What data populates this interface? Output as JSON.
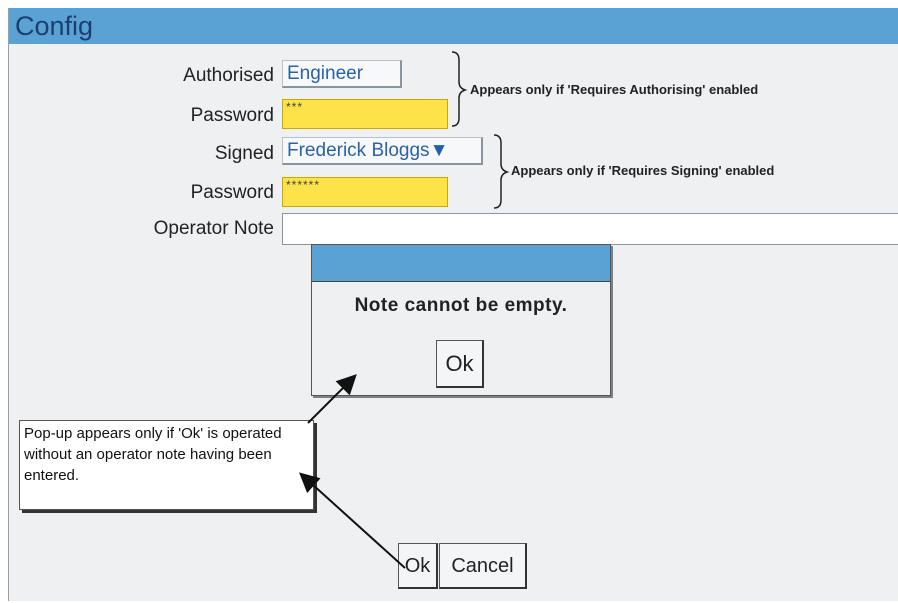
{
  "window": {
    "title": "Config"
  },
  "form": {
    "authorised_label": "Authorised",
    "authorised_value": "Engineer",
    "password1_label": "Password",
    "password1_mask": "***",
    "signed_label": "Signed",
    "signed_value": "Frederick Bloggs",
    "signed_dropdown_glyph": "▼",
    "password2_label": "Password",
    "password2_mask": "******",
    "operator_note_label": "Operator Note",
    "operator_note_value": ""
  },
  "annotations": {
    "authorising_note": "Appears only if 'Requires Authorising' enabled",
    "signing_note": "Appears only if 'Requires Signing' enabled",
    "popup_callout": "Pop-up appears only if 'Ok' is operated without an operator note having been entered."
  },
  "popup": {
    "title": "",
    "message": "Note cannot be empty.",
    "ok_label": "Ok"
  },
  "buttons": {
    "ok_label": "Ok",
    "cancel_label": "Cancel"
  },
  "colors": {
    "titlebar": "#5ba2d4",
    "password_field": "#fde24a",
    "value_text": "#2a62a8"
  }
}
